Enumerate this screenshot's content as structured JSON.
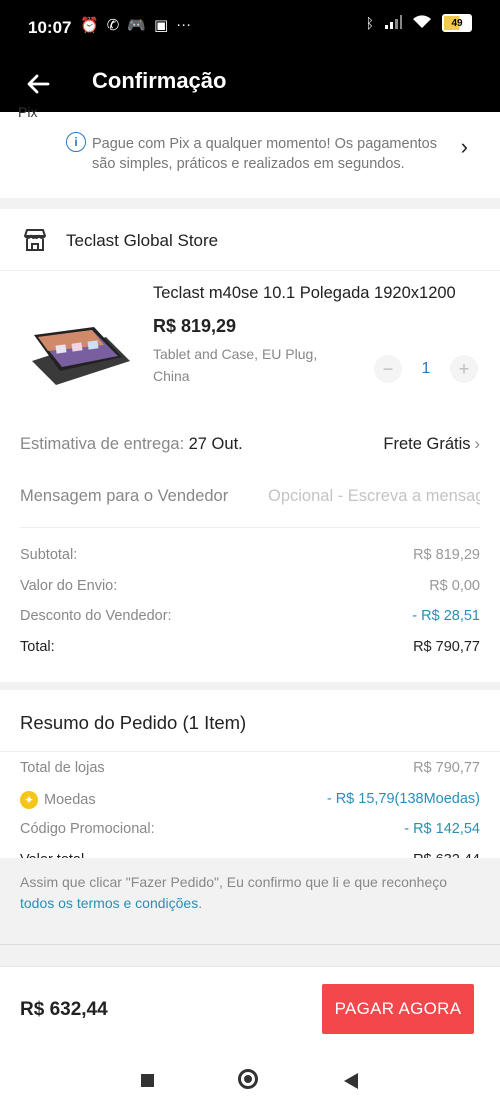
{
  "status_bar": {
    "time": "10:07",
    "left_icons": [
      "alarm-icon",
      "whatsapp-icon",
      "game-icon",
      "screenshot-icon",
      "more-dots-icon"
    ],
    "right_icons": [
      "bluetooth-icon",
      "signal-icon",
      "wifi-icon"
    ],
    "battery": "49"
  },
  "header": {
    "title": "Confirmação"
  },
  "pix": {
    "partial_label": "Pix",
    "info_text": "Pague com Pix a qualquer momento! Os pagamentos são simples, práticos e realizados em segundos."
  },
  "store": {
    "name": "Teclast Global Store",
    "product": {
      "title": "Teclast m40se 10.1 Polegada 1920x1200",
      "price": "R$ 819,29",
      "variant": "Tablet and Case, EU Plug, China",
      "quantity": "1"
    },
    "delivery": {
      "label": "Estimativa de entrega:",
      "date": "27 Out.",
      "shipping": "Frete Grátis"
    },
    "message": {
      "label": "Mensagem para o Vendedor",
      "placeholder": "Opcional - Escreva a mensagem"
    },
    "lines": [
      {
        "label": "Subtotal:",
        "value": "R$ 819,29"
      },
      {
        "label": "Valor do Envio:",
        "value": "R$ 0,00"
      },
      {
        "label": "Desconto do Vendedor:",
        "value": "- R$ 28,51"
      },
      {
        "label": "Total:",
        "value": "R$ 790,77"
      }
    ]
  },
  "order_summary": {
    "title": "Resumo do Pedido (1 Item)",
    "lines": [
      {
        "label": "Total de lojas",
        "value": "R$ 790,77"
      },
      {
        "label": "Moedas",
        "value": "- R$ 15,79(138Moedas)"
      },
      {
        "label": "Código Promocional:",
        "value": "- R$ 142,54"
      },
      {
        "label": "Valor total",
        "value": "R$ 632,44"
      }
    ]
  },
  "terms": {
    "prefix": "Assim que clicar \"Fazer Pedido\", Eu confirmo que li e que reconheço ",
    "link": "todos os termos e condições",
    "suffix": "."
  },
  "bottom": {
    "total": "R$ 632,44",
    "pay_label": "PAGAR AGORA"
  },
  "colors": {
    "accent": "#2a8fb8",
    "pay_button": "#f2474b",
    "coin": "#f5c518"
  }
}
